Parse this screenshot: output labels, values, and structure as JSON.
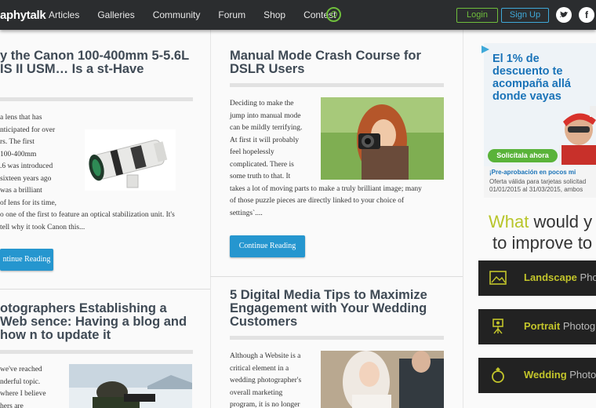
{
  "header": {
    "logo": "aphytalk",
    "nav": [
      "Articles",
      "Galleries",
      "Community",
      "Forum",
      "Shop",
      "Contest"
    ],
    "login": "Login",
    "signup": "Sign Up",
    "twitter_glyph": "🐦",
    "facebook_glyph": "f"
  },
  "articles": [
    {
      "title": "y the Canon 100-400mm 5-5.6L IS II USM… Is a st-Have",
      "body_lines": [
        "a lens that has",
        "nticipated for over",
        "rs. The first",
        "100-400mm",
        ".6 was introduced",
        "sixteen years ago",
        "was a brilliant",
        "of lens for its time,",
        "o one of the first to feature an optical stabilization unit. It's",
        " tell why it took Canon this..."
      ],
      "button": "ntinue Reading"
    },
    {
      "title": "Manual Mode Crash Course for DSLR Users",
      "body_lines": [
        "Deciding to make the",
        "jump into manual mode",
        "can be mildly terrifying.",
        "At first it will probably",
        "feel hopelessly",
        "complicated. There is",
        "some truth to that. It",
        "takes a lot of moving parts to make a truly brilliant image; many",
        "of those puzzle pieces are directly linked to your choice of",
        "settings`...."
      ],
      "button": "Continue Reading"
    },
    {
      "title": "otographers Establishing a Web sence: Having a blog and how n to update it",
      "body_lines": [
        "we've reached",
        "nderful topic.",
        " where I believe",
        "hers are"
      ]
    },
    {
      "title": "5 Digital Media Tips to Maximize Engagement with Your Wedding Customers",
      "body_lines": [
        "Although a Website is a",
        "critical element in a",
        "wedding photographer's",
        "overall marketing",
        "program, it is no longer"
      ]
    }
  ],
  "ad": {
    "headline_lines": [
      "El 1% de",
      "descuento te",
      "acompaña allá",
      "donde vayas"
    ],
    "cta": "Solicítala ahora",
    "fine_print": [
      "¡Pre-aprobación en pocos mi",
      "Oferta válida para tarjetas solicitad",
      "01/01/2015 al 31/03/2015, ambos"
    ]
  },
  "sidebar": {
    "what_prefix": "What",
    "what_rest": " would y",
    "improve": "to improve to",
    "categories": [
      {
        "name": "Landscape",
        "suffix": " Pho"
      },
      {
        "name": "Portrait",
        "suffix": " Photog"
      },
      {
        "name": "Wedding",
        "suffix": " Photo"
      }
    ]
  },
  "colors": {
    "accent_green": "#6fbe3c",
    "accent_blue": "#2596cf",
    "category_text": "#c3c52b"
  }
}
